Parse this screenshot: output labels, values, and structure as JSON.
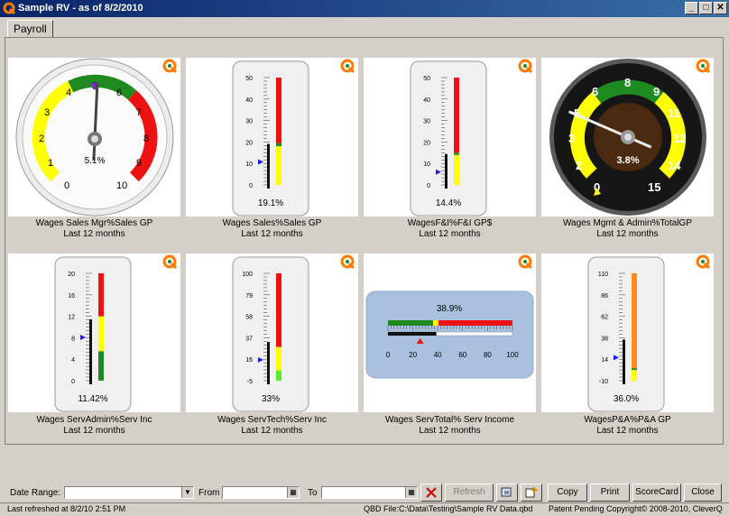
{
  "window": {
    "title": "Sample RV - as of 8/2/2010"
  },
  "tabs": [
    {
      "label": "Payroll"
    }
  ],
  "tiles": [
    {
      "title": "Wages Sales Mgr%Sales GP",
      "period": "Last 12 months",
      "type": "round-dial",
      "value_label": "5.1%",
      "value": 5.1,
      "scale": [
        "0",
        "1",
        "2",
        "3",
        "4",
        "5",
        "6",
        "7",
        "8",
        "9",
        "10"
      ],
      "range": [
        0,
        10
      ]
    },
    {
      "title": "Wages Sales%Sales GP",
      "period": "Last 12 months",
      "type": "thermometer",
      "value_label": "19.1%",
      "value": 19.1,
      "ticks": [
        "50",
        "40",
        "30",
        "20",
        "10",
        "0"
      ],
      "range": [
        0,
        50
      ]
    },
    {
      "title": "WagesF&I%F&I GP$",
      "period": "Last 12 months",
      "type": "thermometer",
      "value_label": "14.4%",
      "value": 14.4,
      "ticks": [
        "50",
        "40",
        "30",
        "20",
        "10",
        "0"
      ],
      "range": [
        0,
        50
      ]
    },
    {
      "title": "Wages Mgmt & Admin%TotalGP",
      "period": "Last 12 months",
      "type": "dark-dial",
      "value_label": "3.8%",
      "value": 3.8,
      "scale": [
        "0",
        "2",
        "3",
        "5",
        "6",
        "8",
        "9",
        "11",
        "12",
        "14",
        "15"
      ],
      "range": [
        0,
        15
      ]
    },
    {
      "title": "Wages ServAdmin%Serv Inc",
      "period": "Last 12 months",
      "type": "thermometer",
      "value_label": "11.42%",
      "value": 11.42,
      "ticks": [
        "20",
        "16",
        "12",
        "8",
        "4",
        "0"
      ],
      "range": [
        0,
        20
      ]
    },
    {
      "title": "Wages ServTech%Serv Inc",
      "period": "Last 12 months",
      "type": "thermometer",
      "value_label": "33%",
      "value": 33,
      "ticks": [
        "100",
        "79",
        "58",
        "37",
        "16",
        "-5"
      ],
      "range": [
        -5,
        100
      ]
    },
    {
      "title": "Wages ServTotal% Serv Income",
      "period": "Last 12 months",
      "type": "horizontal-bar",
      "value_label": "38.9%",
      "value": 38.9,
      "ticks": [
        "0",
        "20",
        "40",
        "60",
        "80",
        "100"
      ],
      "range": [
        0,
        100
      ]
    },
    {
      "title": "WagesP&A%P&A GP",
      "period": "Last 12 months",
      "type": "thermometer",
      "value_label": "36.0%",
      "value": 36.0,
      "ticks": [
        "110",
        "86",
        "62",
        "38",
        "14",
        "-10"
      ],
      "range": [
        -10,
        110
      ]
    }
  ],
  "filters": {
    "date_range_label": "Date Range:",
    "date_range_value": "",
    "from_label": "From",
    "to_label": "To"
  },
  "buttons": {
    "refresh": "Refresh",
    "copy": "Copy",
    "print": "Print",
    "scorecard": "ScoreCard",
    "close": "Close"
  },
  "status": {
    "last_refreshed": "Last refreshed at 8/2/10 2:51 PM",
    "qbd_file": "QBD File:C:\\Data\\Testing\\Sample RV Data.qbd",
    "copyright": "Patent Pending Copyright© 2008-2010, CleverQ"
  },
  "colors": {
    "title_bar": "#0a246a",
    "green": "#1f8a1f",
    "yellow": "#ffff00",
    "red": "#ee1111",
    "orange": "#ff8c1a",
    "pointer": "#1a1aff"
  }
}
